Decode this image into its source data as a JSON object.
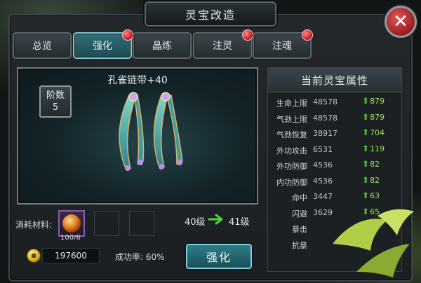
{
  "window": {
    "title": "灵宝改造",
    "close_label": "✕"
  },
  "tabs": [
    {
      "label": "总览",
      "active": false,
      "badge": false
    },
    {
      "label": "强化",
      "active": true,
      "badge": true
    },
    {
      "label": "晶炼",
      "active": false,
      "badge": false
    },
    {
      "label": "注灵",
      "active": false,
      "badge": true
    },
    {
      "label": "注魂",
      "active": false,
      "badge": true
    }
  ],
  "item": {
    "name": "孔雀链带+40",
    "tier_label": "阶数",
    "tier_value": "5"
  },
  "materials": {
    "label": "消耗材料:",
    "count": "100/6"
  },
  "level": {
    "from": "40级",
    "to": "41级"
  },
  "currency": {
    "amount": "197600"
  },
  "success_rate": {
    "label": "成功率: 60%"
  },
  "enhance_button": "强化",
  "attributes": {
    "header": "当前灵宝属性",
    "rows": [
      {
        "name": "生命上限",
        "value": "48578",
        "gain": "879"
      },
      {
        "name": "气劲上限",
        "value": "48578",
        "gain": "879"
      },
      {
        "name": "气劲恢复",
        "value": "38917",
        "gain": "704"
      },
      {
        "name": "外功攻击",
        "value": "6531",
        "gain": "119"
      },
      {
        "name": "外功防御",
        "value": "4536",
        "gain": "82"
      },
      {
        "name": "内功防御",
        "value": "4536",
        "gain": "82"
      },
      {
        "name": "命中",
        "value": "3447",
        "gain": "63"
      },
      {
        "name": "闪避",
        "value": "3629",
        "gain": "65"
      },
      {
        "name": "暴击",
        "value": "",
        "gain": ""
      },
      {
        "name": "抗暴",
        "value": "",
        "gain": ""
      }
    ]
  },
  "colors": {
    "accent": "#2f7d88",
    "gain": "#9be05a",
    "badge": "#c41414"
  }
}
